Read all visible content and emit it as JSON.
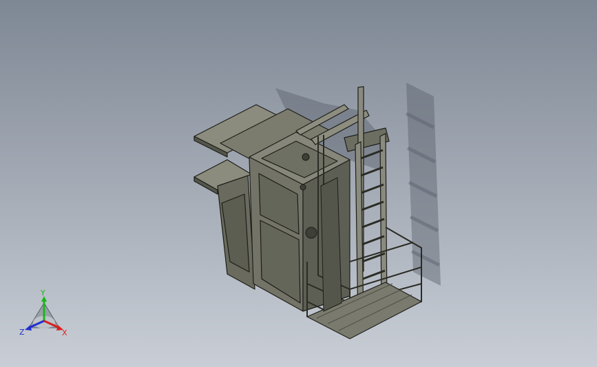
{
  "viewport": {
    "background_top": "#7e8794",
    "background_bottom": "#c9ced6",
    "model_color": "#77786a",
    "edge_color": "#1c1d18"
  },
  "triad": {
    "x_label": "X",
    "y_label": "Y",
    "z_label": "Z",
    "x_color": "#d82020",
    "y_color": "#18b818",
    "z_color": "#2030d0"
  }
}
